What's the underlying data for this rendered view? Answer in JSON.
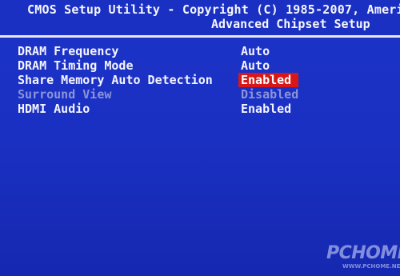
{
  "header": {
    "title": "CMOS Setup Utility - Copyright (C) 1985-2007, Ameri",
    "subtitle": "Advanced Chipset Setup"
  },
  "settings": [
    {
      "label": "DRAM Frequency",
      "value": "Auto",
      "state": "normal"
    },
    {
      "label": "DRAM Timing Mode",
      "value": "Auto",
      "state": "normal"
    },
    {
      "label": "Share Memory Auto Detection",
      "value": "Enabled",
      "state": "selected"
    },
    {
      "label": "Surround View",
      "value": "Disabled",
      "state": "disabled"
    },
    {
      "label": "HDMI Audio",
      "value": "Enabled",
      "state": "normal"
    }
  ],
  "watermark": {
    "brand": "PCHOME",
    "site": "WWW.PCHOME.NET"
  },
  "colors": {
    "background": "#1a30c2",
    "selection": "#d81818",
    "disabled_text": "#8c94d8"
  }
}
